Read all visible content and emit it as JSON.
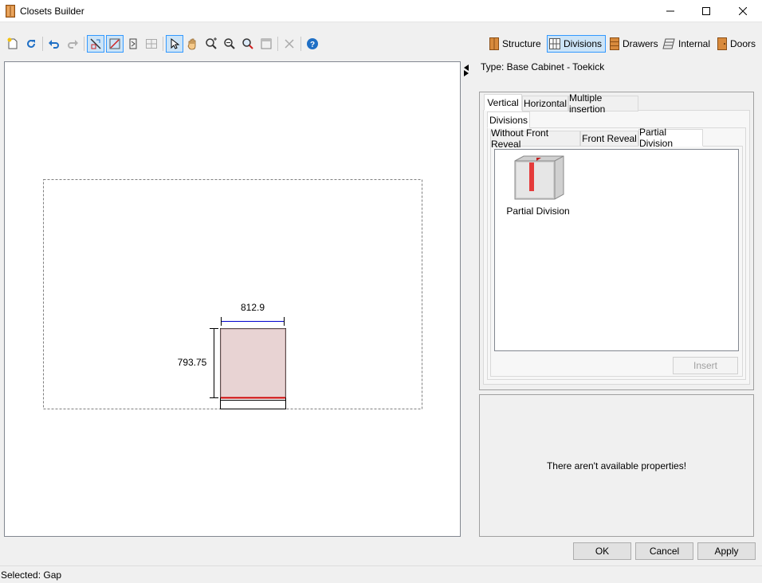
{
  "window": {
    "title": "Closets Builder"
  },
  "toolbar": {
    "structure_label": "Structure",
    "divisions_label": "Divisions",
    "drawers_label": "Drawers",
    "internal_label": "Internal",
    "doors_label": "Doors"
  },
  "canvas": {
    "width_dimension": "812.9",
    "height_dimension": "793.75"
  },
  "panel": {
    "type_label": "Type: Base Cabinet - Toekick",
    "tabs_row1": [
      "Vertical",
      "Horizontal",
      "Multiple insertion"
    ],
    "tab_divisions": "Divisions",
    "tabs_row3": [
      "Without Front Reveal",
      "Front Reveal",
      "Partial Division"
    ],
    "item_label": "Partial Division",
    "insert_label": "Insert",
    "no_properties": "There aren't available properties!"
  },
  "buttons": {
    "ok": "OK",
    "cancel": "Cancel",
    "apply": "Apply"
  },
  "status": {
    "text": "Selected: Gap"
  },
  "colors": {
    "accent": "#3399ff",
    "cabinet_fill": "#e8d3d3",
    "dimension_blue": "#0000cc",
    "toekick_red": "#cc0000"
  }
}
